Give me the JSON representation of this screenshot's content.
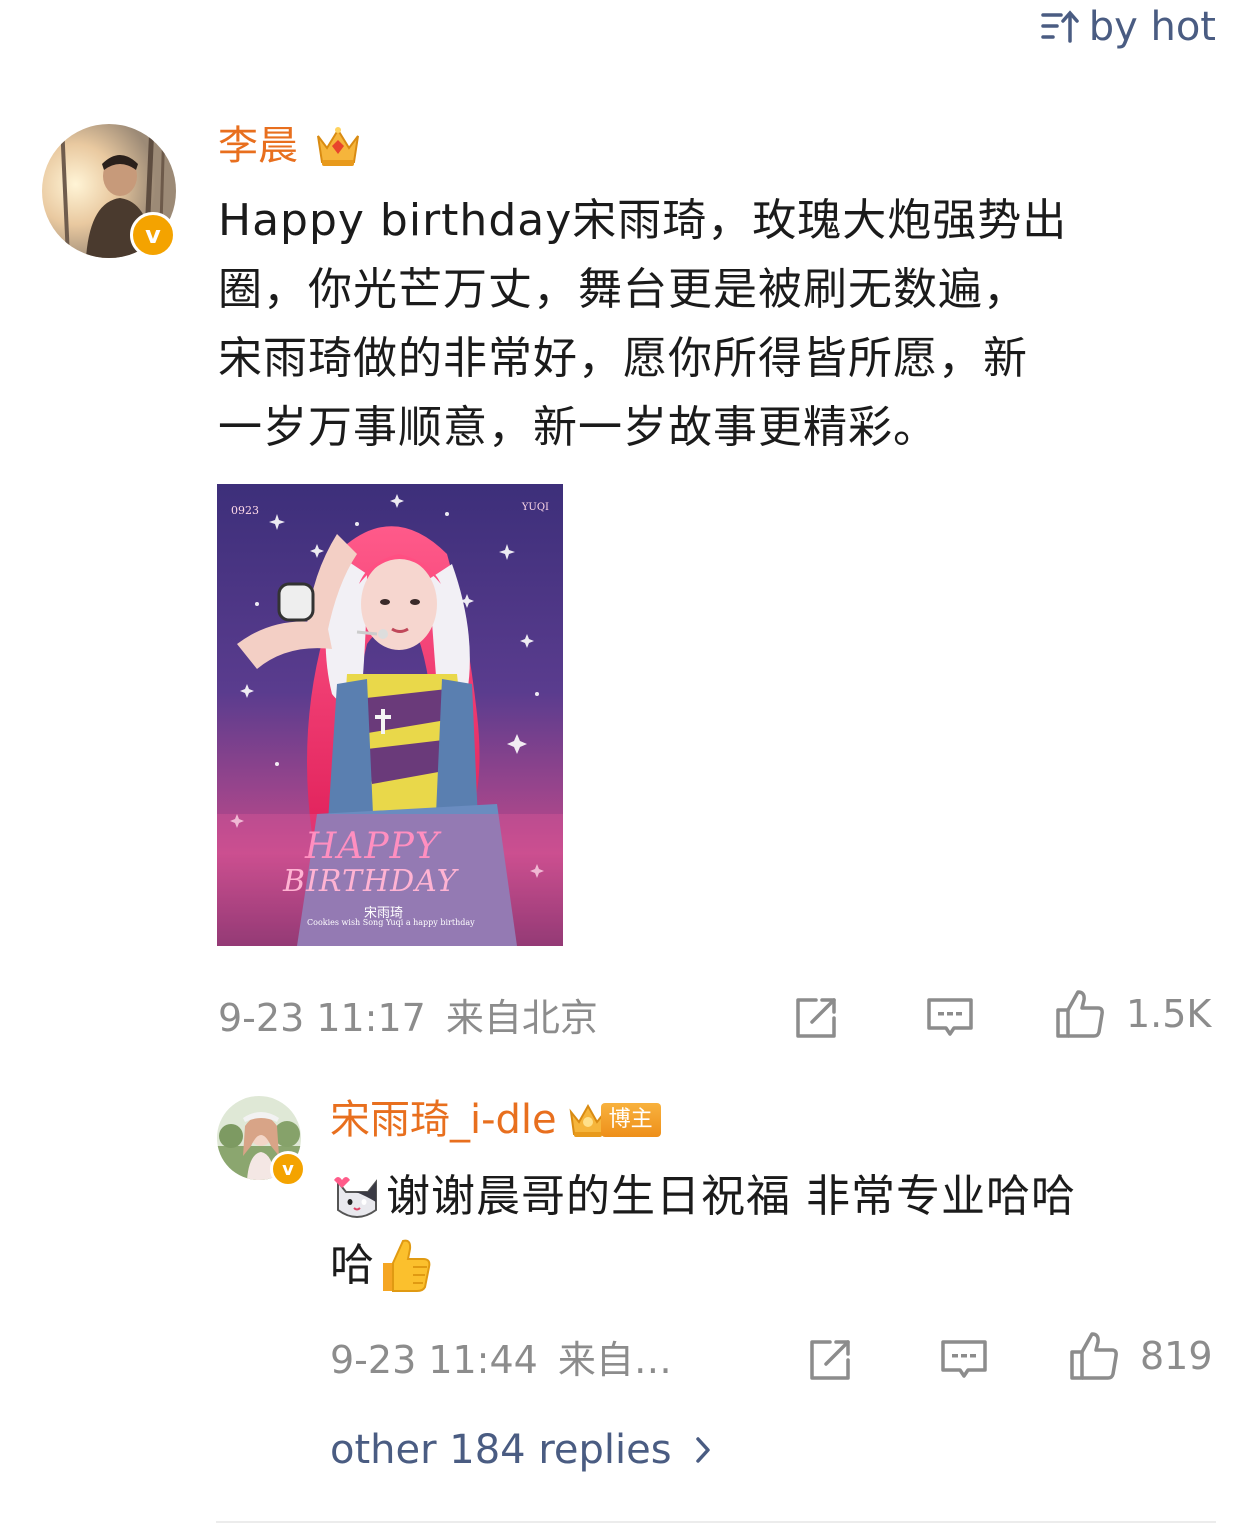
{
  "sort": {
    "label": "by hot",
    "icon": "sort-icon"
  },
  "comment": {
    "author": "李晨",
    "author_badge": "crown-badge-icon",
    "text_lines": [
      "Happy birthday宋雨琦，玫瑰大炮强势出",
      "圈，你光芒万丈，舞台更是被刷无数遍，",
      "宋雨琦做的非常好，愿你所得皆所愿，新",
      "一岁万事顺意，新一岁故事更精彩。"
    ],
    "image": {
      "corner_left": "0923",
      "corner_right": "YUQI",
      "headline_1": "HAPPY",
      "headline_2": "BIRTHDAY",
      "name": "宋雨琦",
      "caption": "Cookies wish Song Yuqi a happy birthday"
    },
    "time": "9-23 11:17",
    "location": "来自北京",
    "likes": "1.5K"
  },
  "reply": {
    "author": "宋雨琦_i-dle",
    "author_tag": "博主",
    "text_line1": "谢谢晨哥的生日祝福 非常专业哈哈",
    "text_line2": "哈",
    "time": "9-23 11:44",
    "location": "来自…",
    "likes": "819"
  },
  "more_replies": "other 184 replies",
  "colors": {
    "name": "#e86f1e",
    "link": "#4a5c82",
    "meta": "#8c8c8c",
    "badge": "#f4a300"
  }
}
